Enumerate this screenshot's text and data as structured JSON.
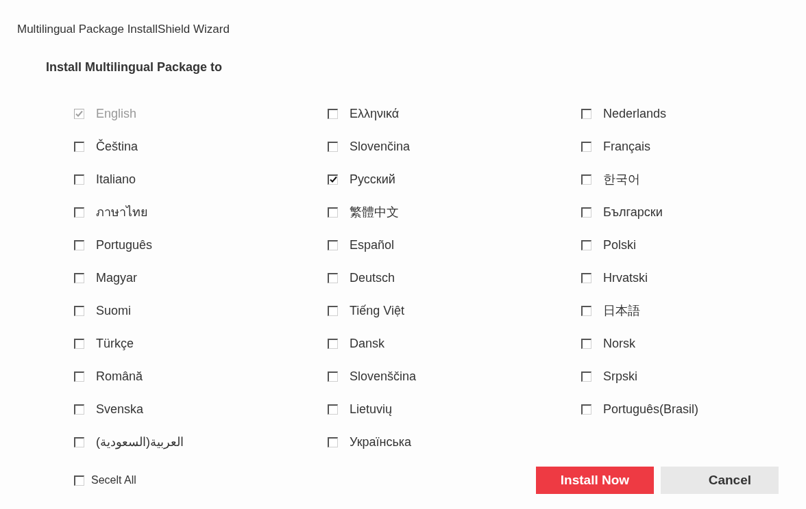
{
  "window": {
    "title": "Multilingual Package InstallShield Wizard"
  },
  "heading": "Install Multilingual Package to",
  "columns": [
    [
      {
        "label": "English",
        "checked": true,
        "disabled": true
      },
      {
        "label": "Čeština",
        "checked": false,
        "disabled": false
      },
      {
        "label": "Italiano",
        "checked": false,
        "disabled": false
      },
      {
        "label": "ภาษาไทย",
        "checked": false,
        "disabled": false
      },
      {
        "label": "Português",
        "checked": false,
        "disabled": false
      },
      {
        "label": "Magyar",
        "checked": false,
        "disabled": false
      },
      {
        "label": "Suomi",
        "checked": false,
        "disabled": false
      },
      {
        "label": "Türkçe",
        "checked": false,
        "disabled": false
      },
      {
        "label": "Română",
        "checked": false,
        "disabled": false
      },
      {
        "label": "Svenska",
        "checked": false,
        "disabled": false
      },
      {
        "label": "العربية(السعودية)",
        "checked": false,
        "disabled": false
      }
    ],
    [
      {
        "label": "Ελληνικά",
        "checked": false,
        "disabled": false
      },
      {
        "label": "Slovenčina",
        "checked": false,
        "disabled": false
      },
      {
        "label": "Русский",
        "checked": true,
        "disabled": false
      },
      {
        "label": "繁體中文",
        "checked": false,
        "disabled": false
      },
      {
        "label": "Español",
        "checked": false,
        "disabled": false
      },
      {
        "label": "Deutsch",
        "checked": false,
        "disabled": false
      },
      {
        "label": "Tiếng Việt",
        "checked": false,
        "disabled": false
      },
      {
        "label": "Dansk",
        "checked": false,
        "disabled": false
      },
      {
        "label": "Slovenščina",
        "checked": false,
        "disabled": false
      },
      {
        "label": "Lietuvių",
        "checked": false,
        "disabled": false
      },
      {
        "label": "Українська",
        "checked": false,
        "disabled": false
      }
    ],
    [
      {
        "label": "Nederlands",
        "checked": false,
        "disabled": false
      },
      {
        "label": "Français",
        "checked": false,
        "disabled": false
      },
      {
        "label": "한국어",
        "checked": false,
        "disabled": false
      },
      {
        "label": "Български",
        "checked": false,
        "disabled": false
      },
      {
        "label": "Polski",
        "checked": false,
        "disabled": false
      },
      {
        "label": "Hrvatski",
        "checked": false,
        "disabled": false
      },
      {
        "label": "日本語",
        "checked": false,
        "disabled": false
      },
      {
        "label": "Norsk",
        "checked": false,
        "disabled": false
      },
      {
        "label": "Srpski",
        "checked": false,
        "disabled": false
      },
      {
        "label": "Português(Brasil)",
        "checked": false,
        "disabled": false
      }
    ]
  ],
  "select_all": {
    "label": "Secelt All",
    "checked": false
  },
  "buttons": [
    {
      "label": "Install Now",
      "kind": "primary"
    },
    {
      "label": "Cancel",
      "kind": "secondary"
    }
  ]
}
